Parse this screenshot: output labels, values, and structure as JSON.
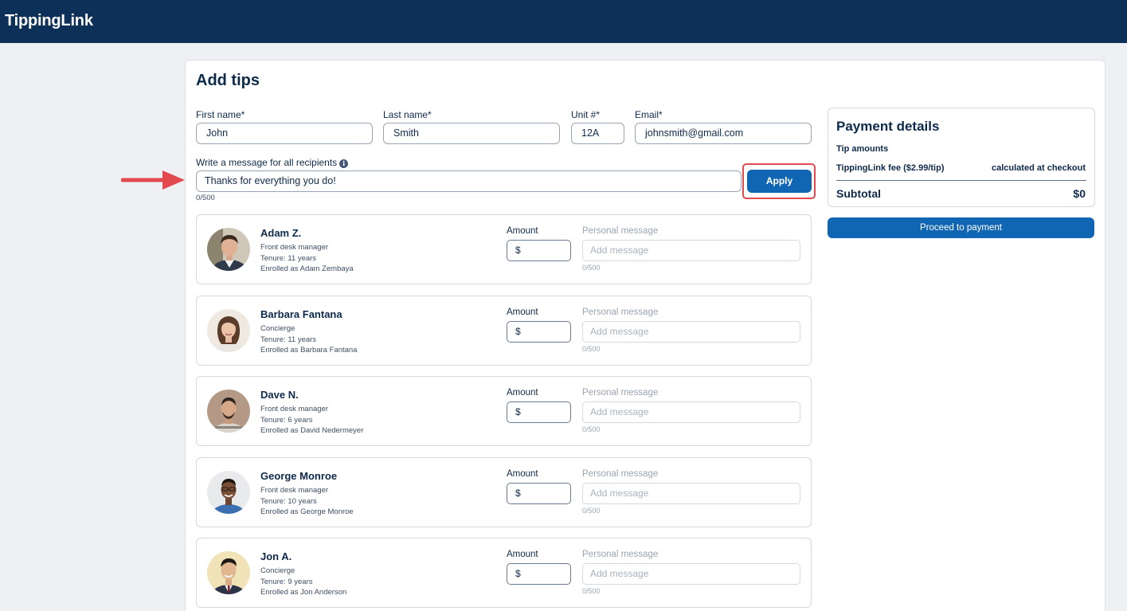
{
  "app": {
    "brand": "TippingLink"
  },
  "page": {
    "title": "Add tips"
  },
  "form": {
    "first_name_label": "First name*",
    "first_name_value": "John",
    "last_name_label": "Last name*",
    "last_name_value": "Smith",
    "unit_label": "Unit #*",
    "unit_value": "12A",
    "email_label": "Email*",
    "email_value": "johnsmith@gmail.com",
    "message_label": "Write a message for all recipients",
    "message_value": "Thanks for everything you do!",
    "message_counter": "0/500",
    "apply_label": "Apply"
  },
  "recipients": [
    {
      "name": "Adam Z.",
      "role": "Front desk manager",
      "tenure": "Tenure: 11 years",
      "enrolled": "Enrolled as Adam Zembaya"
    },
    {
      "name": "Barbara Fantana",
      "role": "Concierge",
      "tenure": "Tenure: 11 years",
      "enrolled": "Enrolled as Barbara Fantana"
    },
    {
      "name": "Dave N.",
      "role": "Front desk manager",
      "tenure": "Tenure: 6 years",
      "enrolled": "Enrolled as David Nedermeyer"
    },
    {
      "name": "George Monroe",
      "role": "Front desk manager",
      "tenure": "Tenure: 10 years",
      "enrolled": "Enrolled as George Monroe"
    },
    {
      "name": "Jon A.",
      "role": "Concierge",
      "tenure": "Tenure: 9 years",
      "enrolled": "Enrolled as Jon Anderson"
    }
  ],
  "recipient_fields": {
    "amount_label": "Amount",
    "currency_symbol": "$",
    "personal_message_label": "Personal message",
    "personal_message_placeholder": "Add message",
    "personal_message_counter": "0/500"
  },
  "payment": {
    "title": "Payment details",
    "tip_amounts_label": "Tip amounts",
    "fee_label": "TippingLink fee ($2.99/tip)",
    "fee_value": "calculated at checkout",
    "subtotal_label": "Subtotal",
    "subtotal_value": "$0",
    "proceed_label": "Proceed to payment"
  },
  "colors": {
    "nav_bg": "#0c3057",
    "primary_button": "#1166b3",
    "highlight": "#e24a4f"
  }
}
